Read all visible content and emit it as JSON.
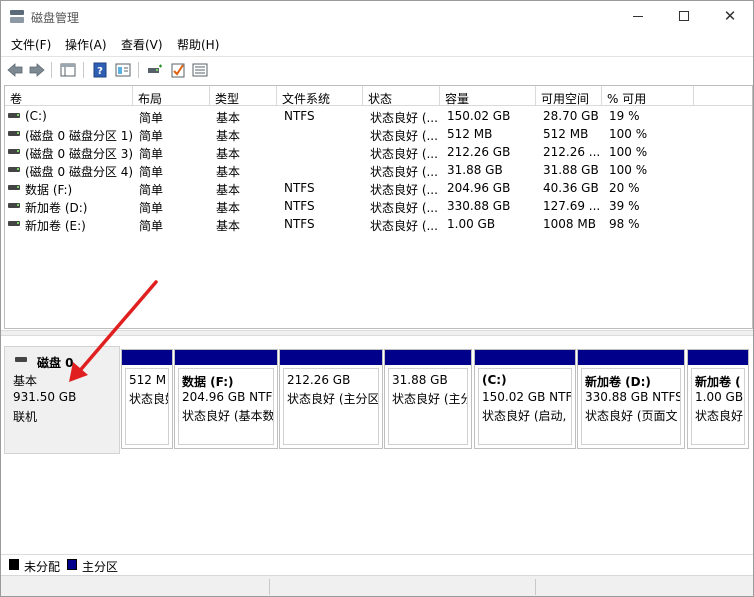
{
  "window": {
    "title": "磁盘管理"
  },
  "menu": {
    "items": [
      "文件(F)",
      "操作(A)",
      "查看(V)",
      "帮助(H)"
    ]
  },
  "toolbar": {
    "icons": [
      "back-arrow-icon",
      "forward-arrow-icon",
      "console-tree-icon",
      "help-icon",
      "properties-icon",
      "connect-disk-icon",
      "check-icon",
      "list-view-icon"
    ]
  },
  "volume_table": {
    "columns": [
      "卷",
      "布局",
      "类型",
      "文件系统",
      "状态",
      "容量",
      "可用空间",
      "% 可用"
    ],
    "rows": [
      [
        "(C:)",
        "简单",
        "基本",
        "NTFS",
        "状态良好 (...",
        "150.02 GB",
        "28.70 GB",
        "19 %"
      ],
      [
        "(磁盘 0 磁盘分区 1)",
        "简单",
        "基本",
        "",
        "状态良好 (...",
        "512 MB",
        "512 MB",
        "100 %"
      ],
      [
        "(磁盘 0 磁盘分区 3)",
        "简单",
        "基本",
        "",
        "状态良好 (...",
        "212.26 GB",
        "212.26 ...",
        "100 %"
      ],
      [
        "(磁盘 0 磁盘分区 4)",
        "简单",
        "基本",
        "",
        "状态良好 (...",
        "31.88 GB",
        "31.88 GB",
        "100 %"
      ],
      [
        "数据 (F:)",
        "简单",
        "基本",
        "NTFS",
        "状态良好 (...",
        "204.96 GB",
        "40.36 GB",
        "20 %"
      ],
      [
        "新加卷 (D:)",
        "简单",
        "基本",
        "NTFS",
        "状态良好 (...",
        "330.88 GB",
        "127.69 ...",
        "39 %"
      ],
      [
        "新加卷 (E:)",
        "简单",
        "基本",
        "NTFS",
        "状态良好 (...",
        "1.00 GB",
        "1008 MB",
        "98 %"
      ]
    ]
  },
  "disk0": {
    "name": "磁盘 0",
    "type": "基本",
    "size": "931.50 GB",
    "status": "联机",
    "partitions": [
      {
        "title": "",
        "size": "512 M",
        "status": "状态良好"
      },
      {
        "title": "数据 (F:)",
        "size": "204.96 GB NTFS",
        "status": "状态良好 (基本数"
      },
      {
        "title": "",
        "size": "212.26 GB",
        "status": "状态良好 (主分区"
      },
      {
        "title": "",
        "size": "31.88 GB",
        "status": "状态良好 (主分"
      },
      {
        "title": "(C:)",
        "size": "150.02 GB NTF",
        "status": "状态良好 (启动,"
      },
      {
        "title": "新加卷 (D:)",
        "size": "330.88 GB NTFS",
        "status": "状态良好 (页面文"
      },
      {
        "title": "新加卷 (",
        "size": "1.00 GB",
        "status": "状态良好"
      }
    ]
  },
  "legend": {
    "unallocated": "未分配",
    "primary": "主分区"
  },
  "colors": {
    "primary_partition": "#00008b",
    "unallocated": "#000000",
    "annotation_arrow": "#e02020"
  }
}
